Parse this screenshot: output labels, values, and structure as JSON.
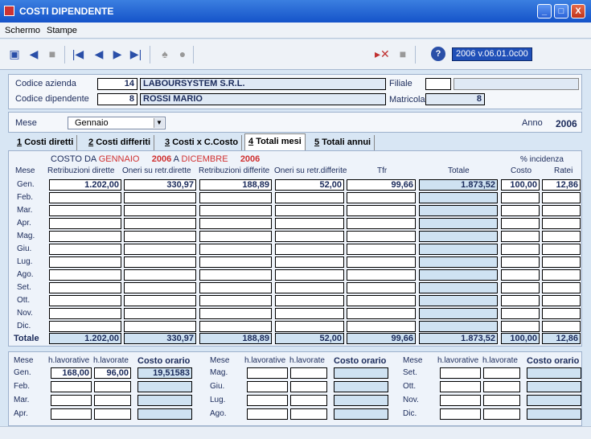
{
  "window": {
    "title": "COSTI DIPENDENTE",
    "min": "_",
    "max": "□",
    "close": "X"
  },
  "menu": [
    {
      "label": "Schermo"
    },
    {
      "label": "Stampe"
    }
  ],
  "toolbar": {
    "version": "2006 v.06.01.0c00"
  },
  "header": {
    "codice_azienda_label": "Codice azienda",
    "codice_azienda_value": "14",
    "azienda_name": "LABOURSYSTEM S.R.L.",
    "filiale_label": "Filiale",
    "filiale_value": "",
    "filiale_desc": "",
    "codice_dipendente_label": "Codice dipendente",
    "codice_dipendente_value": "8",
    "dipendente_name": "ROSSI MARIO",
    "matricola_label": "Matricola",
    "matricola_value": "8"
  },
  "mese_row": {
    "label": "Mese",
    "selected": "Gennaio",
    "anno_label": "Anno",
    "anno_value": "2006"
  },
  "tabs": [
    {
      "num": "1",
      "label": "Costi diretti"
    },
    {
      "num": "2",
      "label": "Costi differiti"
    },
    {
      "num": "3",
      "label": "Costi x C.Costo"
    },
    {
      "num": "4",
      "label": "Totali mesi"
    },
    {
      "num": "5",
      "label": "Totali annui"
    }
  ],
  "range": {
    "costo_da": "COSTO DA",
    "from_month": "GENNAIO",
    "from_year": "2006",
    "a": "A",
    "to_month": "DICEMBRE",
    "to_year": "2006"
  },
  "incidenza_label": "% incidenza",
  "columns": {
    "mese": "Mese",
    "retr_dirette": "Retribuzioni dirette",
    "oneri_dirette": "Oneri su retr.dirette",
    "retr_differite": "Retribuzioni differite",
    "oneri_differite": "Oneri su retr.differite",
    "tfr": "Tfr",
    "totale": "Totale",
    "costo": "Costo",
    "ratei": "Ratei"
  },
  "rows": [
    {
      "month": "Gen.",
      "v": [
        "1.202,00",
        "330,97",
        "188,89",
        "52,00",
        "99,66",
        "1.873,52",
        "100,00",
        "12,86"
      ]
    },
    {
      "month": "Feb.",
      "v": [
        "",
        "",
        "",
        "",
        "",
        "",
        "",
        ""
      ]
    },
    {
      "month": "Mar.",
      "v": [
        "",
        "",
        "",
        "",
        "",
        "",
        "",
        ""
      ]
    },
    {
      "month": "Apr.",
      "v": [
        "",
        "",
        "",
        "",
        "",
        "",
        "",
        ""
      ]
    },
    {
      "month": "Mag.",
      "v": [
        "",
        "",
        "",
        "",
        "",
        "",
        "",
        ""
      ]
    },
    {
      "month": "Giu.",
      "v": [
        "",
        "",
        "",
        "",
        "",
        "",
        "",
        ""
      ]
    },
    {
      "month": "Lug.",
      "v": [
        "",
        "",
        "",
        "",
        "",
        "",
        "",
        ""
      ]
    },
    {
      "month": "Ago.",
      "v": [
        "",
        "",
        "",
        "",
        "",
        "",
        "",
        ""
      ]
    },
    {
      "month": "Set.",
      "v": [
        "",
        "",
        "",
        "",
        "",
        "",
        "",
        ""
      ]
    },
    {
      "month": "Ott.",
      "v": [
        "",
        "",
        "",
        "",
        "",
        "",
        "",
        ""
      ]
    },
    {
      "month": "Nov.",
      "v": [
        "",
        "",
        "",
        "",
        "",
        "",
        "",
        ""
      ]
    },
    {
      "month": "Dic.",
      "v": [
        "",
        "",
        "",
        "",
        "",
        "",
        "",
        ""
      ]
    }
  ],
  "totale_row": {
    "label": "Totale",
    "v": [
      "1.202,00",
      "330,97",
      "188,89",
      "52,00",
      "99,66",
      "1.873,52",
      "100,00",
      "12,86"
    ]
  },
  "hours": {
    "mese": "Mese",
    "h_lavorative": "h.lavorative",
    "h_lavorate": "h.lavorate",
    "costo_orario": "Costo orario",
    "groups": [
      [
        {
          "month": "Gen.",
          "hlav": "168,00",
          "hlvt": "96,00",
          "costo": "19,51583"
        },
        {
          "month": "Feb.",
          "hlav": "",
          "hlvt": "",
          "costo": ""
        },
        {
          "month": "Mar.",
          "hlav": "",
          "hlvt": "",
          "costo": ""
        },
        {
          "month": "Apr.",
          "hlav": "",
          "hlvt": "",
          "costo": ""
        }
      ],
      [
        {
          "month": "Mag.",
          "hlav": "",
          "hlvt": "",
          "costo": ""
        },
        {
          "month": "Giu.",
          "hlav": "",
          "hlvt": "",
          "costo": ""
        },
        {
          "month": "Lug.",
          "hlav": "",
          "hlvt": "",
          "costo": ""
        },
        {
          "month": "Ago.",
          "hlav": "",
          "hlvt": "",
          "costo": ""
        }
      ],
      [
        {
          "month": "Set.",
          "hlav": "",
          "hlvt": "",
          "costo": ""
        },
        {
          "month": "Ott.",
          "hlav": "",
          "hlvt": "",
          "costo": ""
        },
        {
          "month": "Nov.",
          "hlav": "",
          "hlvt": "",
          "costo": ""
        },
        {
          "month": "Dic.",
          "hlav": "",
          "hlvt": "",
          "costo": ""
        }
      ]
    ]
  }
}
